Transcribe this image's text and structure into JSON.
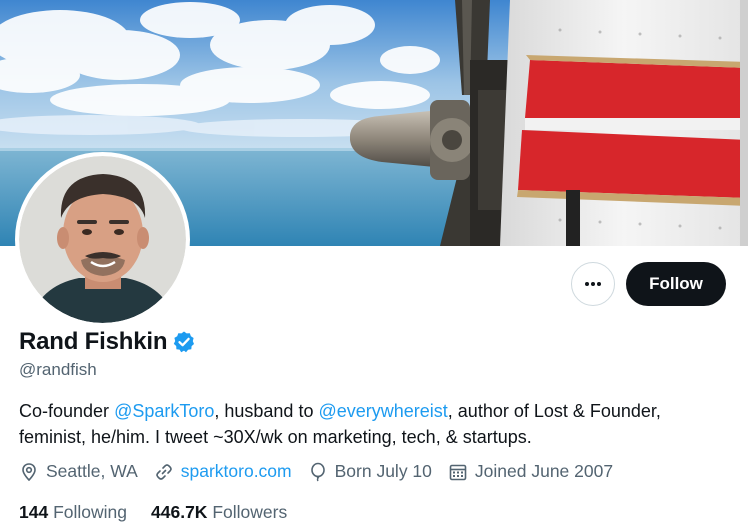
{
  "profile": {
    "display_name": "Rand Fishkin",
    "handle": "@randfish",
    "verified": true
  },
  "actions": {
    "more_icon": "more-horizontal-icon",
    "follow_label": "Follow"
  },
  "bio": {
    "part1": "Co-founder ",
    "mention1": "@SparkToro",
    "part2": ", husband to ",
    "mention2": "@everywhereist",
    "part3": ", author of Lost & Founder, feminist, he/him. I tweet ~30X/wk on marketing, tech, & startups."
  },
  "meta": {
    "location": "Seattle, WA",
    "website": "sparktoro.com",
    "birthday": "Born July 10",
    "joined": "Joined June 2007"
  },
  "counts": {
    "following_value": "144",
    "following_label": "Following",
    "followers_value": "446.7K",
    "followers_label": "Followers"
  },
  "colors": {
    "accent": "#1d9bf0",
    "text_primary": "#0f1419",
    "text_secondary": "#536471",
    "follow_button_bg": "#0f1419"
  }
}
